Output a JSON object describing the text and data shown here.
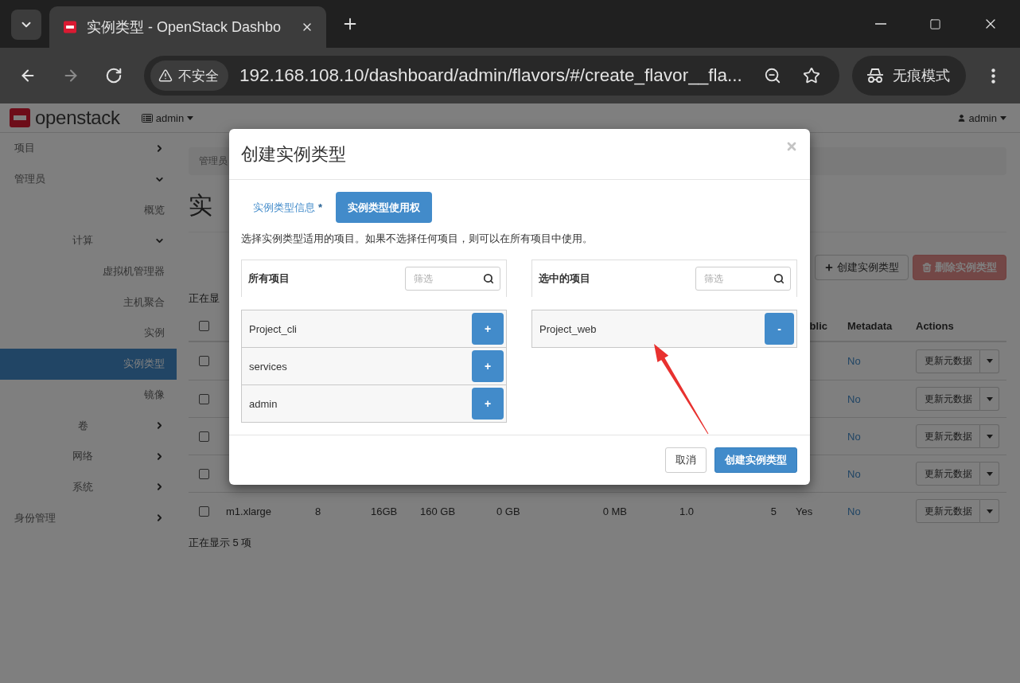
{
  "browser": {
    "tab_title": "实例类型 - OpenStack Dashbo",
    "nav_buttons": [
      {
        "kind": "back",
        "disabled": false
      },
      {
        "kind": "forward",
        "disabled": true
      },
      {
        "kind": "reload",
        "disabled": false
      }
    ],
    "security_label": "不安全",
    "url": "192.168.108.10/dashboard/admin/flavors/#/create_flavor__fla...",
    "incognito_label": "无痕模式"
  },
  "header": {
    "brand": "openstack",
    "project": "admin",
    "user": "admin"
  },
  "sidebar": {
    "items": [
      {
        "label": "项目",
        "expanded": false
      },
      {
        "label": "管理员",
        "expanded": true,
        "children": [
          {
            "label": "概览",
            "selected": false
          },
          {
            "label": "计算",
            "expanded": true,
            "children": [
              {
                "label": "虚拟机管理器",
                "selected": false
              },
              {
                "label": "主机聚合",
                "selected": false
              },
              {
                "label": "实例",
                "selected": false
              },
              {
                "label": "实例类型",
                "selected": true
              },
              {
                "label": "镜像",
                "selected": false
              }
            ]
          },
          {
            "label": "卷",
            "expanded": false
          },
          {
            "label": "网络",
            "expanded": false
          },
          {
            "label": "系统",
            "expanded": false
          }
        ]
      },
      {
        "label": "身份管理",
        "expanded": false
      }
    ]
  },
  "content": {
    "breadcrumb": "管理员",
    "heading": "实",
    "actions": [
      {
        "kind": "create",
        "label": "创建实例类型",
        "disabled": false
      },
      {
        "kind": "delete",
        "label": "删除实例类型",
        "disabled": true
      }
    ],
    "count_top": "正在显",
    "table": {
      "columns": [
        {
          "kind": "checkbox",
          "checked": false
        },
        {
          "kind": "public",
          "label": "blic"
        },
        {
          "kind": "metadata",
          "label": "Metadata"
        },
        {
          "kind": "actions",
          "label": "Actions"
        }
      ],
      "rows": [
        {
          "checked": false,
          "metadata": "No",
          "action": "更新元数据"
        },
        {
          "checked": false,
          "metadata": "No",
          "action": "更新元数据"
        },
        {
          "checked": false,
          "metadata": "No",
          "action": "更新元数据"
        },
        {
          "checked": false,
          "metadata": "No",
          "action": "更新元数据"
        },
        {
          "checked": false,
          "cells": [
            "m1.xlarge",
            "8",
            "16GB",
            "160 GB",
            "0 GB",
            "0 MB",
            "1.0",
            "5",
            "Yes"
          ],
          "metadata": "No",
          "action": "更新元数据"
        }
      ]
    },
    "count_bottom": "正在显示 5 项"
  },
  "modal": {
    "title": "创建实例类型",
    "tabs": [
      {
        "label": "实例类型信息",
        "marker": "*",
        "selected": false
      },
      {
        "label": "实例类型使用权",
        "selected": true
      }
    ],
    "description": "选择实例类型适用的项目。如果不选择任何项目，则可以在所有项目中使用。",
    "panels": [
      {
        "kind": "available",
        "title": "所有项目",
        "filter_placeholder": "筛选",
        "items": [
          {
            "name": "Project_cli",
            "button": "+"
          },
          {
            "name": "services",
            "button": "+"
          },
          {
            "name": "admin",
            "button": "+"
          }
        ]
      },
      {
        "kind": "selected",
        "title": "选中的项目",
        "filter_placeholder": "筛选",
        "items": [
          {
            "name": "Project_web",
            "button": "-"
          }
        ]
      }
    ],
    "buttons": [
      {
        "kind": "default",
        "label": "取消"
      },
      {
        "kind": "primary",
        "label": "创建实例类型"
      }
    ]
  }
}
